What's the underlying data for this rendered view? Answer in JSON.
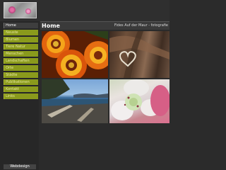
{
  "logo": {
    "alt": "Fides Auf der Maur logo"
  },
  "header": {
    "page_title": "Home",
    "site_title": "Fides Auf der Maur - fotografie"
  },
  "nav": {
    "items": [
      {
        "label": "Home",
        "active": true
      },
      {
        "label": "Neuste",
        "active": false
      },
      {
        "label": "Blumen",
        "active": false
      },
      {
        "label": "Tiere Natur",
        "active": false
      },
      {
        "label": "Menschen",
        "active": false
      },
      {
        "label": "Landschaften",
        "active": false
      },
      {
        "label": "Orte",
        "active": false
      },
      {
        "label": "Städte",
        "active": false
      },
      {
        "label": "Publikationen",
        "active": false
      },
      {
        "label": "Kontakt",
        "active": false
      },
      {
        "label": "Links",
        "active": false
      }
    ]
  },
  "footer": {
    "label": "Webdesign"
  },
  "gallery": [
    {
      "subject": "orange gazania flowers"
    },
    {
      "subject": "wooden branch with heart"
    },
    {
      "subject": "coast with driftwood"
    },
    {
      "subject": "pink hellebore flower"
    }
  ],
  "colors": {
    "nav_green": "#8a9a1c",
    "nav_active": "#3e3e3e",
    "background": "#2b2b2b"
  }
}
